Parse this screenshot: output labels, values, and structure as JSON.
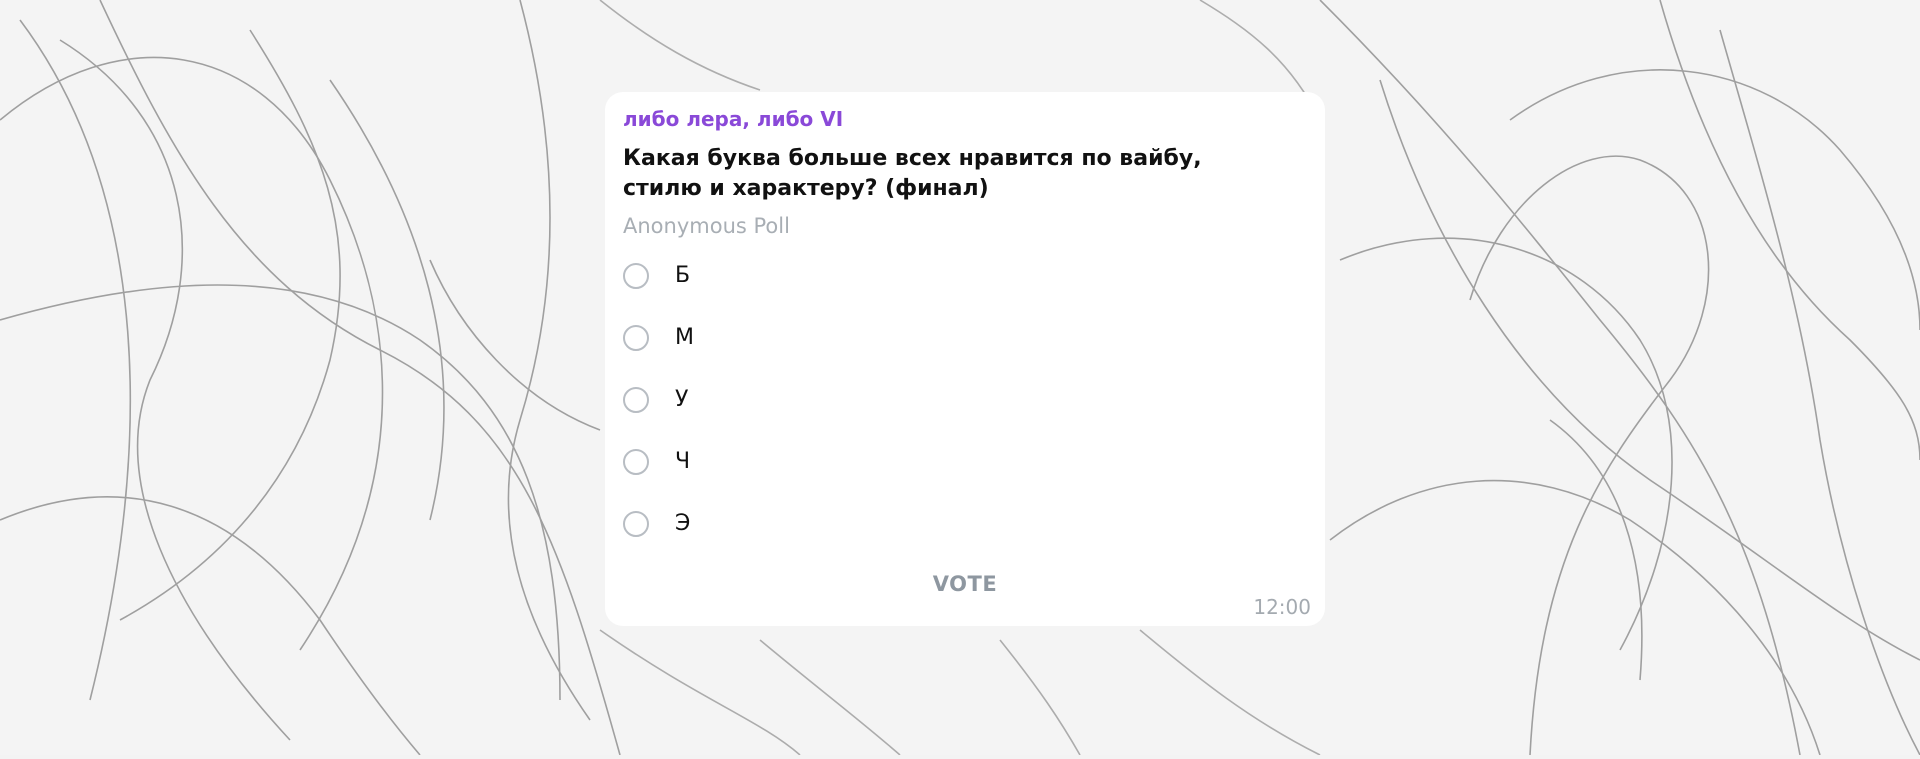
{
  "message": {
    "sender": "либо лера, либо VI",
    "question": "Какая буква больше всех нравится по вайбу, стилю и характеру? (финал)",
    "poll_type": "Anonymous Poll",
    "options": [
      {
        "label": "Б"
      },
      {
        "label": "М"
      },
      {
        "label": "У"
      },
      {
        "label": "Ч"
      },
      {
        "label": "Э"
      }
    ],
    "vote_label": "VOTE",
    "time": "12:00"
  },
  "colors": {
    "sender": "#8a49d8",
    "radio_border": "#b8bdc3",
    "muted_text": "#a8aeb4",
    "vote_text": "#8e97a0"
  }
}
